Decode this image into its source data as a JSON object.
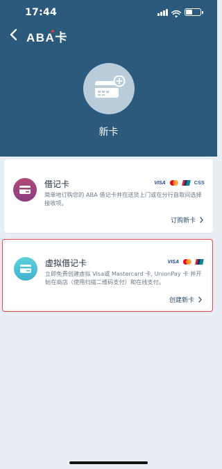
{
  "status": {
    "time": "17:44"
  },
  "nav": {
    "title": "ABA卡"
  },
  "hero": {
    "label": "新卡"
  },
  "cards": [
    {
      "title": "借记卡",
      "description": "简单地订购您的 ABA 借记卡并在送货上门或在分行自取间选择接收项。",
      "brands": [
        "VISA",
        "Mastercard",
        "UnionPay",
        "CSS"
      ],
      "visa_text": "VISA",
      "css_text": "CSS",
      "action": "订购新卡"
    },
    {
      "title": "虚拟借记卡",
      "description": "立即免费创建虚拟 Visa或 Mastercard 卡, UnionPay 卡 并开始在商店（使用扫描二维码支付）和在线支付。",
      "brands": [
        "VISA",
        "Mastercard",
        "UnionPay"
      ],
      "visa_text": "VISA",
      "action": "创建新卡"
    }
  ],
  "colors": {
    "header": "#2c5a7d",
    "background": "#e8eef3",
    "debit_icon": "#9b4479",
    "virtual_icon": "#4cc3d5",
    "highlight_border": "#e2474a"
  }
}
